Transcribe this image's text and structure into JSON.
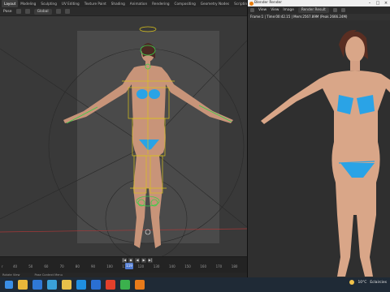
{
  "blender": {
    "workspace_tabs": [
      "Layout",
      "Modeling",
      "Sculpting",
      "UV Editing",
      "Texture Paint",
      "Shading",
      "Animation",
      "Rendering",
      "Compositing",
      "Geometry Nodes",
      "Scripting"
    ],
    "active_tab": "Layout",
    "mode": "Pose",
    "orientation": "Global",
    "timeline_ticks": [
      "40",
      "50",
      "60",
      "70",
      "80",
      "90",
      "100",
      "110",
      "120",
      "130",
      "140",
      "150",
      "160",
      "170",
      "180"
    ],
    "frame_marker": "r",
    "current_frame": "119",
    "status_left": "Rotate View",
    "status_right": "Pose Context Menu"
  },
  "render_window": {
    "title": "Blender Render",
    "menu": [
      "View",
      "View",
      "Image"
    ],
    "slot": "Render Result",
    "info": "Frame:1 | Time:00:42.15 | Mem:2567.89M (Peak 2666.24M)"
  },
  "taskbar": {
    "temperature": "10°C",
    "weather": "Eclaircies",
    "icon_colors": [
      "#e9b73a",
      "#2f78d6",
      "#3aa0d8",
      "#e8c04a",
      "#1f8fe0",
      "#2a6fd3",
      "#e2402b",
      "#3bb14d",
      "#e77a1a"
    ]
  },
  "colors": {
    "accent": "#4f7ad1",
    "bikini": "#2aa3e6",
    "bone_yellow": "#d9c21b",
    "bone_green": "#3ccd4a"
  }
}
